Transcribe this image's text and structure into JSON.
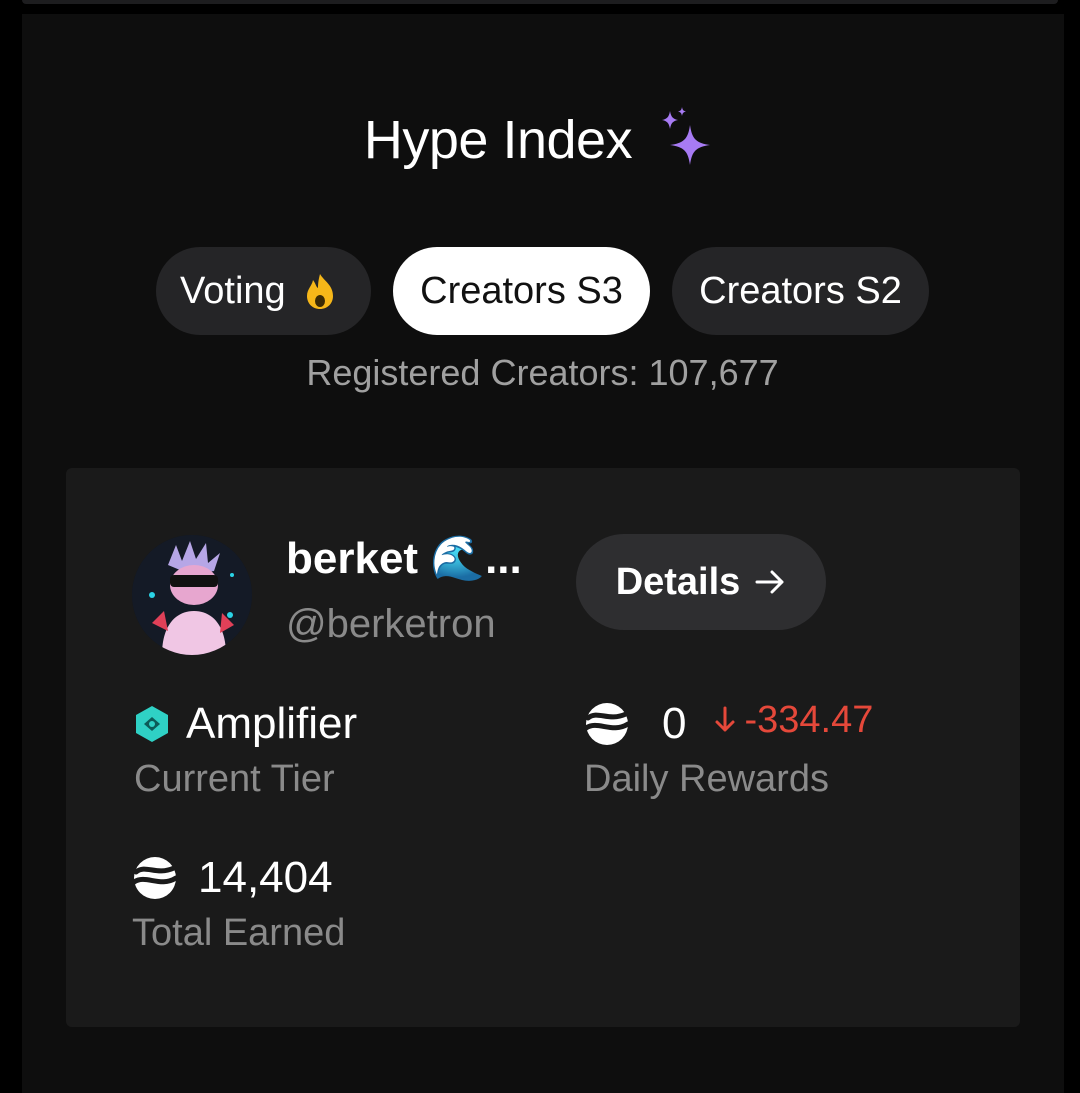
{
  "header": {
    "title": "Hype Index",
    "title_icon": "sparkles-icon"
  },
  "tabs": [
    {
      "label": "Voting",
      "icon": "fire-icon",
      "active": false
    },
    {
      "label": "Creators S3",
      "active": true
    },
    {
      "label": "Creators S2",
      "active": false
    }
  ],
  "registered_creators": "Registered Creators: 107,677",
  "creator_card": {
    "display_name": "berket 🌊...",
    "handle": "@berketron",
    "details_label": "Details",
    "tier": {
      "value": "Amplifier",
      "label": "Current Tier",
      "icon": "diamond-tier-icon"
    },
    "daily_rewards": {
      "value": "0",
      "change": "-334.47",
      "label": "Daily Rewards",
      "icon": "coin-icon"
    },
    "total_earned": {
      "value": "14,404",
      "label": "Total Earned",
      "icon": "coin-icon"
    }
  },
  "colors": {
    "background": "#0e0e0e",
    "card": "#1a1a1a",
    "tab_active_bg": "#ffffff",
    "tab_bg": "#252527",
    "accent_tier": "#2fd1c5",
    "negative": "#e5483a",
    "sparkle": "#a77bf3"
  }
}
